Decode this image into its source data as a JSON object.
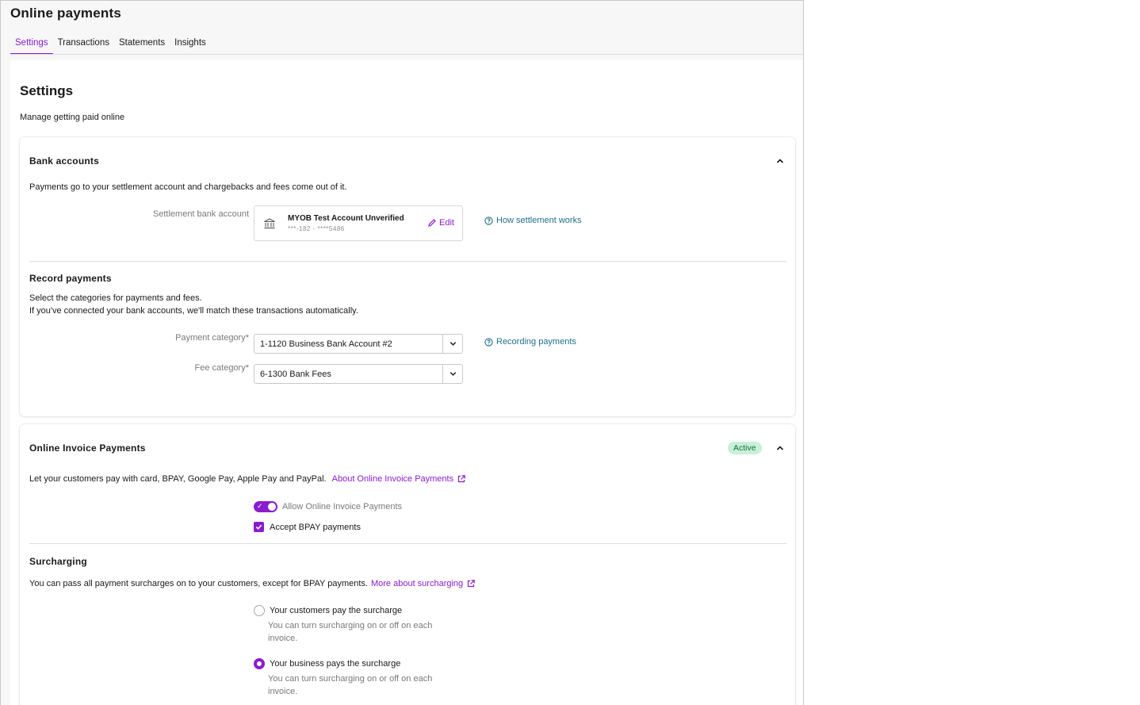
{
  "header": {
    "title": "Online payments",
    "tabs": [
      {
        "label": "Settings"
      },
      {
        "label": "Transactions"
      },
      {
        "label": "Statements"
      },
      {
        "label": "Insights"
      }
    ]
  },
  "settings": {
    "title": "Settings",
    "subtitle": "Manage getting paid online"
  },
  "bank_accounts": {
    "title": "Bank accounts",
    "description": "Payments go to your settlement account and chargebacks and fees come out of it.",
    "settlement_label": "Settlement bank account",
    "account_name": "MYOB Test Account Unverified",
    "account_number": "***-182 - ****5486",
    "edit_label": "Edit",
    "help_link": "How settlement works"
  },
  "record_payments": {
    "title": "Record payments",
    "line1": "Select the categories for payments and fees.",
    "line2": "If you've connected your bank accounts, we'll match these transactions automatically.",
    "payment_category_label": "Payment category*",
    "payment_category_value": "1-1120  Business Bank Account #2",
    "fee_category_label": "Fee category*",
    "fee_category_value": "6-1300  Bank Fees",
    "help_link": "Recording payments"
  },
  "online_invoice": {
    "title": "Online Invoice Payments",
    "status": "Active",
    "description": "Let your customers pay with card, BPAY, Google Pay, Apple Pay and PayPal.",
    "about_link": "About Online Invoice Payments",
    "allow_label": "Allow Online Invoice Payments",
    "allow_on": true,
    "bpay_label": "Accept BPAY payments",
    "bpay_checked": true
  },
  "surcharging": {
    "title": "Surcharging",
    "description": "You can pass all payment surcharges on to your customers, except for BPAY payments.",
    "more_link": "More about surcharging",
    "option1_label": "Your customers pay the surcharge",
    "option1_help_1": "You can turn surcharging on or off on each",
    "option1_help_2": "invoice.",
    "option2_label": "Your business pays the surcharge",
    "option2_help_1": "You can turn surcharging on or off on each",
    "option2_help_2": "invoice.",
    "selected": "Your business pays the surcharge"
  },
  "colors": {
    "accent": "#8a1ccf",
    "link_teal": "#1f6f8b",
    "active_badge_bg": "#c8f0d8"
  }
}
